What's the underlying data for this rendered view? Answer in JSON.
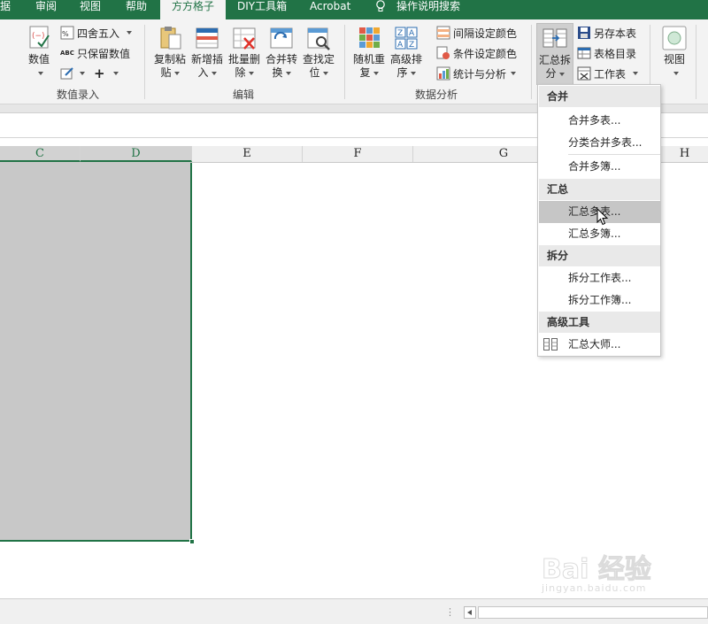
{
  "tabs": [
    {
      "label": "据"
    },
    {
      "label": "审阅"
    },
    {
      "label": "视图"
    },
    {
      "label": "帮助"
    },
    {
      "label": "方方格子"
    },
    {
      "label": "DIY工具箱"
    },
    {
      "label": "Acrobat"
    }
  ],
  "tell_me": "操作说明搜索",
  "ribbon": {
    "groups": {
      "numeric": "数值录入",
      "edit": "编辑",
      "analysis": "数据分析"
    },
    "numeric": {
      "value_label": "数值",
      "round_label": "四舍五入",
      "keep_values_label": "只保留数值",
      "abc_tag": "ABC"
    },
    "edit": {
      "copy_paste": [
        "复制粘",
        "贴"
      ],
      "add_insert": [
        "新增插",
        "入"
      ],
      "batch_delete": [
        "批量删",
        "除"
      ],
      "merge_convert": [
        "合并转",
        "换"
      ],
      "find_locate": [
        "查找定",
        "位"
      ]
    },
    "analysis": {
      "random_repeat": [
        "随机重",
        "复"
      ],
      "advanced_sort": [
        "高级排",
        "序"
      ],
      "interval_color": "间隔设定颜色",
      "conditional_color": "条件设定颜色",
      "stats": "统计与分析"
    },
    "summary": {
      "summarize_split": [
        "汇总拆",
        "分"
      ],
      "save_copy": "另存本表",
      "sheet_index": "表格目录",
      "worksheet": "工作表"
    },
    "view_label": "视图"
  },
  "columns": [
    "C",
    "D",
    "E",
    "F",
    "G",
    "H"
  ],
  "menu": {
    "sections": [
      {
        "title": "合并",
        "items": [
          "合并多表...",
          "分类合并多表...",
          "合并多簿..."
        ]
      },
      {
        "title": "汇总",
        "items": [
          "汇总多表...",
          "汇总多簿..."
        ]
      },
      {
        "title": "拆分",
        "items": [
          "拆分工作表...",
          "拆分工作簿..."
        ]
      },
      {
        "title": "高级工具",
        "items": [
          "汇总大师..."
        ]
      }
    ],
    "hovered": "汇总多表..."
  },
  "statusbar": {
    "dots": "⋮"
  },
  "watermark": {
    "text": "Bai 经验",
    "sub": "jingyan.baidu.com"
  },
  "colors": {
    "accent": "#217346",
    "selection": "#c8c8c8",
    "ribbon": "#f3f3f3"
  }
}
